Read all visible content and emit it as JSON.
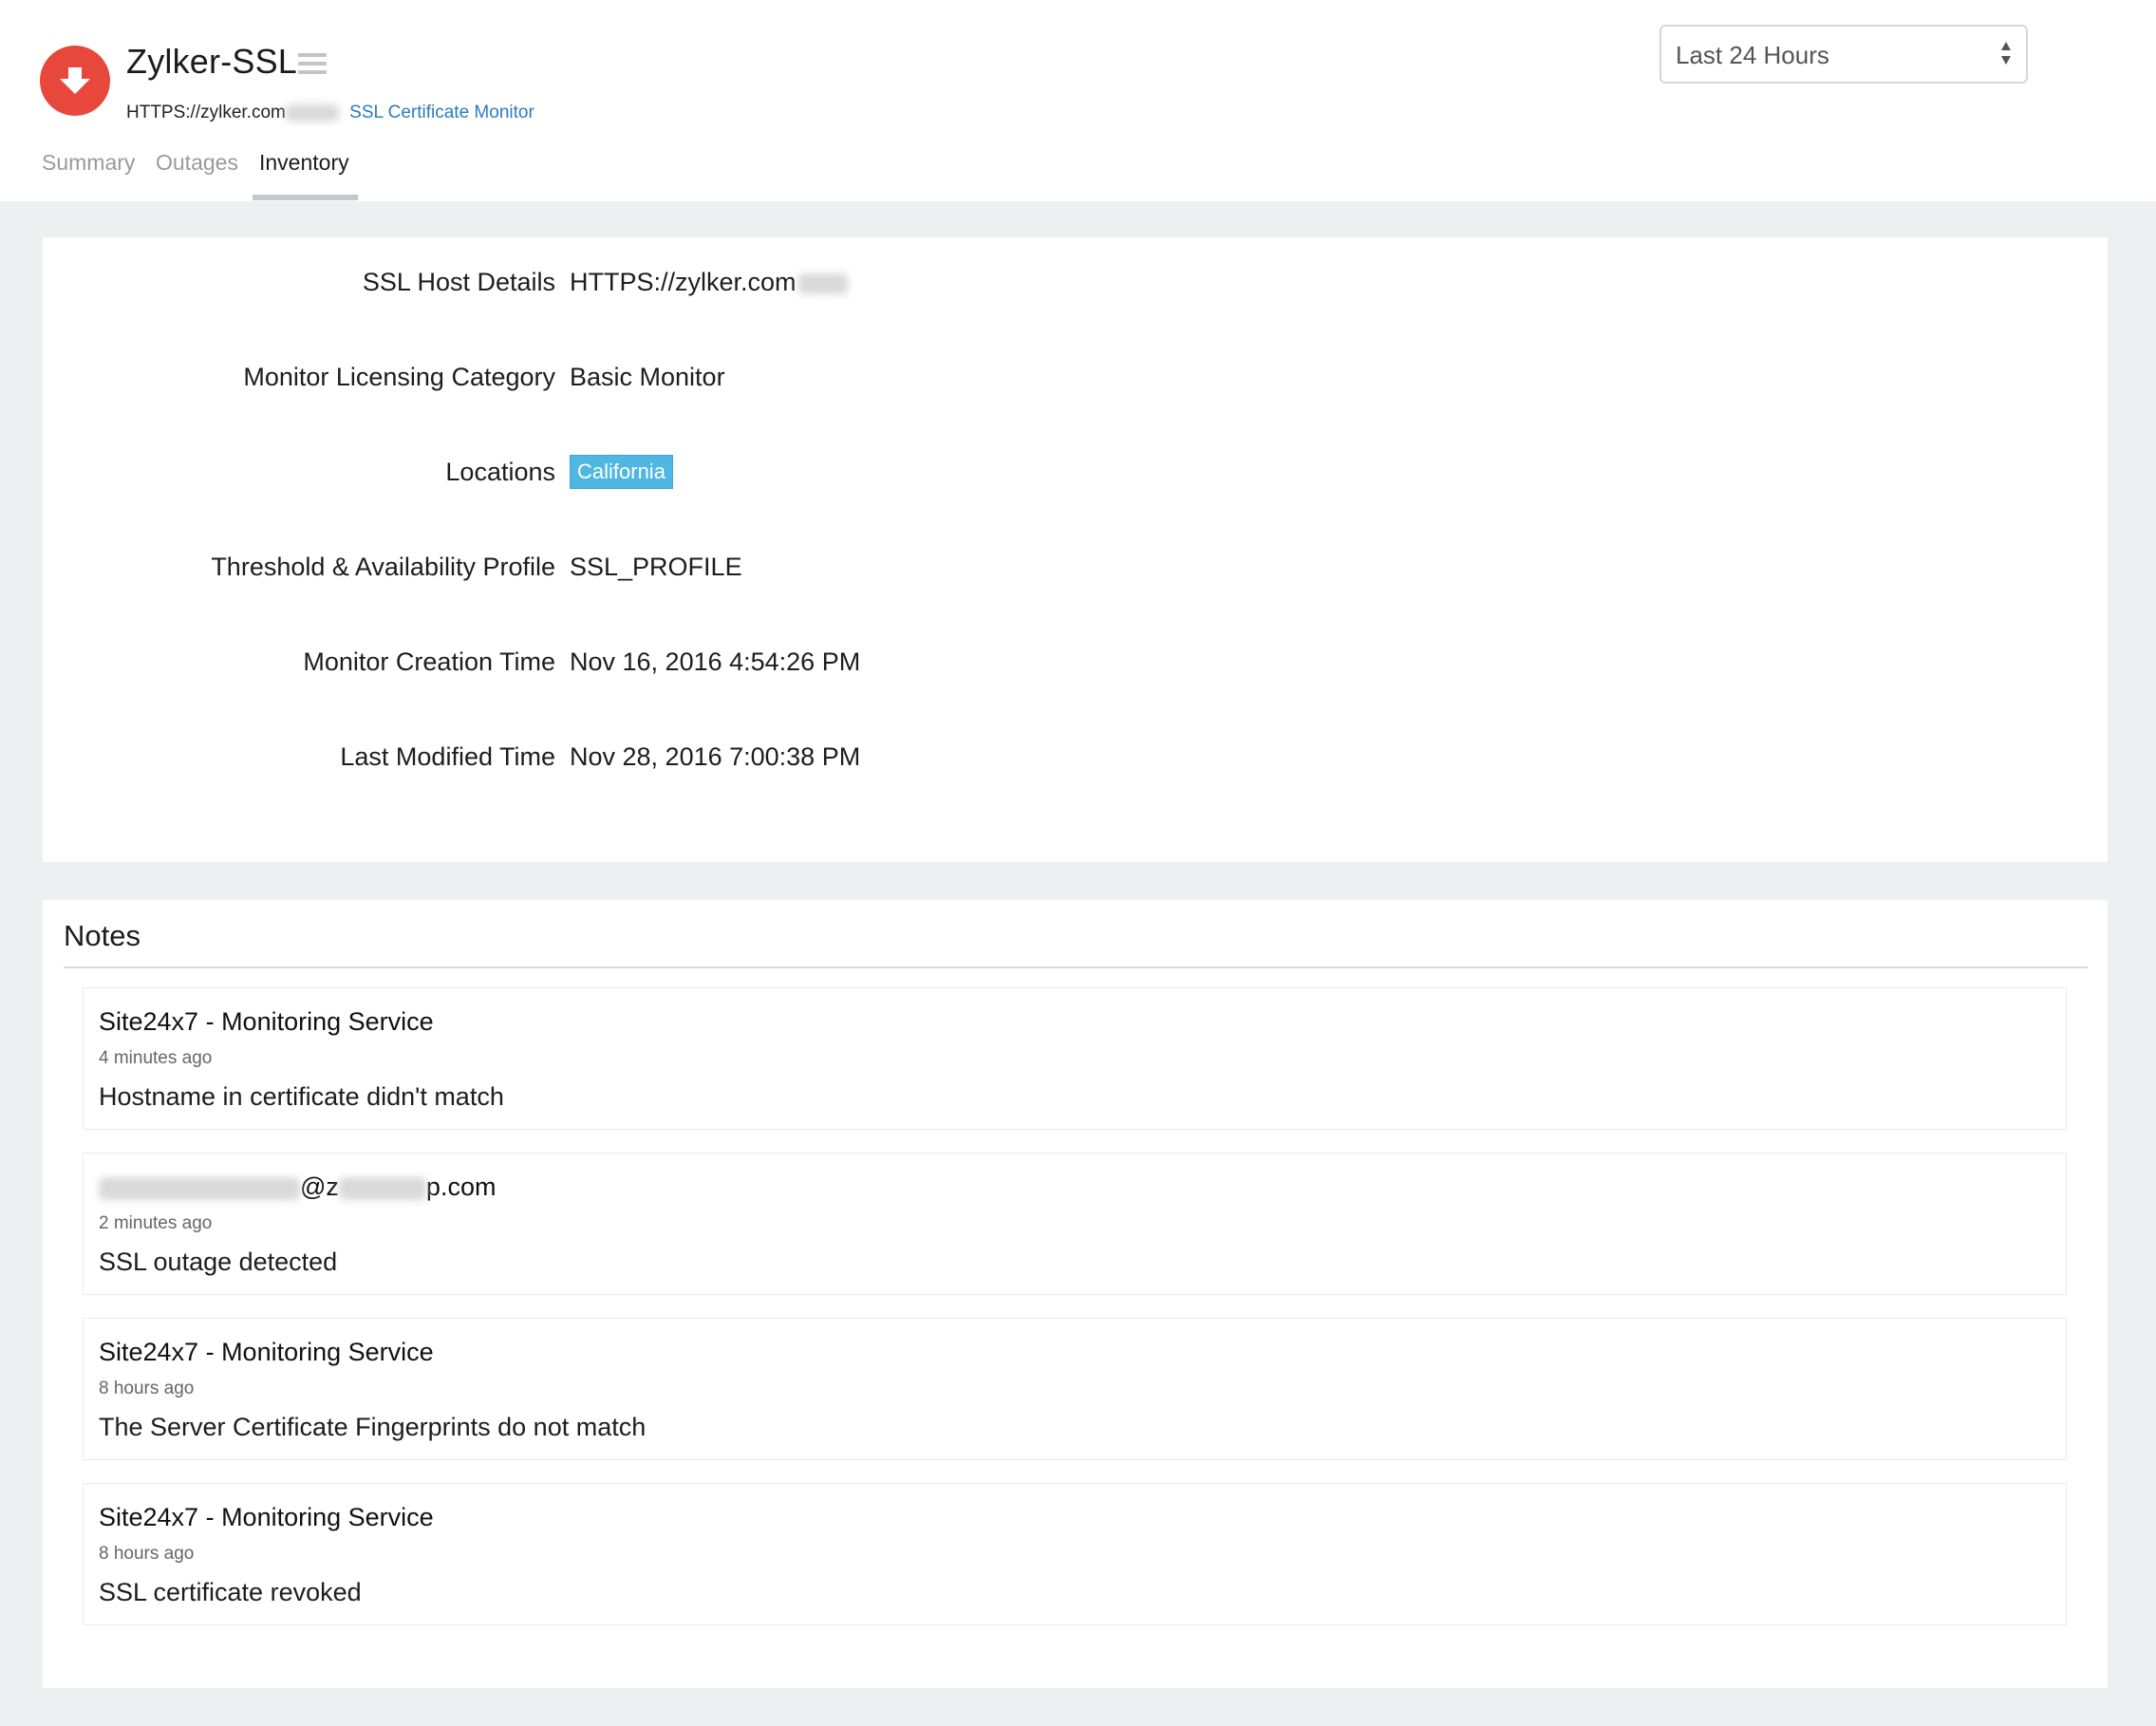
{
  "colors": {
    "status_down": "#e8483b",
    "link": "#2a7bc3",
    "location_tag": "#4fb7e1",
    "page_bg": "#eeeff1"
  },
  "header": {
    "status_icon": "arrow-down-icon",
    "monitor_name": "Zylker-SSL",
    "menu_icon": "hamburger-menu-icon",
    "url": "HTTPS://zylker.com",
    "monitor_type": "SSL Certificate Monitor"
  },
  "tabs": [
    {
      "label": "Summary",
      "active": false
    },
    {
      "label": "Outages",
      "active": false
    },
    {
      "label": "Inventory",
      "active": true
    }
  ],
  "time_range": {
    "selected": "Last 24 Hours"
  },
  "inventory": {
    "ssl_host": {
      "label": "SSL Host Details",
      "value": "HTTPS://zylker.com"
    },
    "licensing": {
      "label": "Monitor Licensing Category",
      "value": "Basic Monitor"
    },
    "locations": {
      "label": "Locations",
      "tags": [
        "California"
      ]
    },
    "profile": {
      "label": "Threshold & Availability Profile",
      "value": "SSL_PROFILE"
    },
    "created": {
      "label": "Monitor Creation Time",
      "value": "Nov 16, 2016 4:54:26 PM"
    },
    "modified": {
      "label": "Last Modified Time",
      "value": "Nov 28, 2016 7:00:38 PM"
    }
  },
  "notes": {
    "title": "Notes",
    "items": [
      {
        "author": "Site24x7 - Monitoring Service",
        "ago": "4 minutes ago",
        "message": "Hostname in certificate didn't match"
      },
      {
        "author_visible_part_1": "@z",
        "author_visible_part_2": "p.com",
        "ago": "2 minutes ago",
        "message": "SSL outage detected"
      },
      {
        "author": "Site24x7 - Monitoring Service",
        "ago": "8 hours ago",
        "message": "The Server Certificate Fingerprints do not match"
      },
      {
        "author": "Site24x7 - Monitoring Service",
        "ago": "8 hours ago",
        "message": "SSL certificate revoked"
      }
    ]
  }
}
